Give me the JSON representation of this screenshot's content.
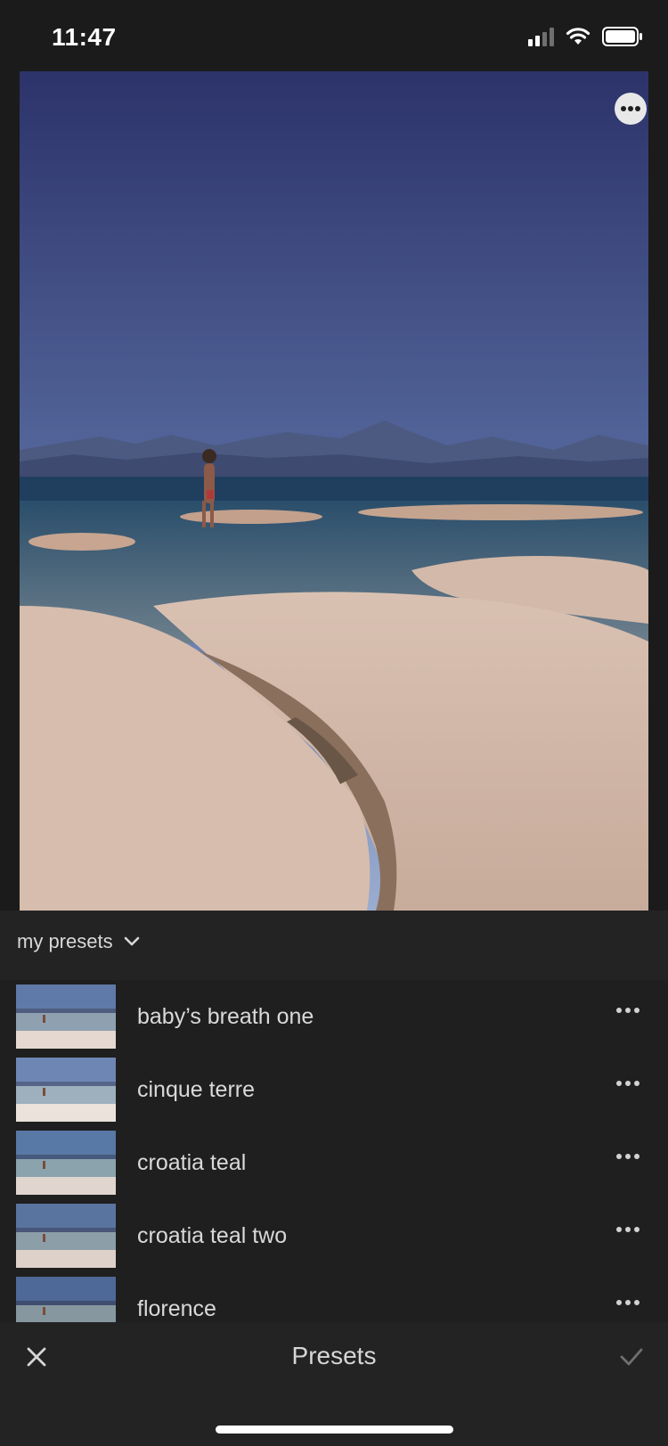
{
  "status_bar": {
    "time": "11:47"
  },
  "presets": {
    "group_label": "my presets",
    "items": [
      {
        "name": "baby’s breath one"
      },
      {
        "name": "cinque terre"
      },
      {
        "name": "croatia teal"
      },
      {
        "name": "croatia teal two"
      },
      {
        "name": "florence"
      }
    ]
  },
  "bottom_bar": {
    "title": "Presets"
  },
  "icons": {
    "photo_more": "more-horizontal-circle-icon",
    "group_dropdown": "chevron-down-icon",
    "row_more": "more-horizontal-icon",
    "close": "close-icon",
    "confirm": "checkmark-icon"
  },
  "colors": {
    "background": "#1b1b1b",
    "panel": "#232323",
    "text": "#d9d9d9"
  }
}
